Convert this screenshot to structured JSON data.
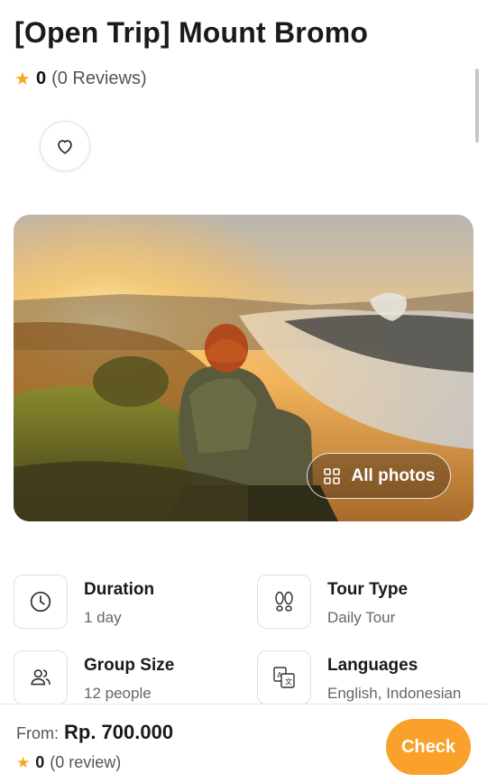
{
  "header": {
    "title": "[Open Trip] Mount Bromo",
    "rating_score": "0",
    "rating_reviews": "(0 Reviews)"
  },
  "gallery": {
    "all_photos_label": "All photos"
  },
  "features": [
    {
      "label": "Duration",
      "value": "1 day",
      "icon": "clock-icon"
    },
    {
      "label": "Tour Type",
      "value": "Daily Tour",
      "icon": "footprints-icon"
    },
    {
      "label": "Group Size",
      "value": "12 people",
      "icon": "group-icon"
    },
    {
      "label": "Languages",
      "value": "English, Indonesian",
      "icon": "translate-icon"
    }
  ],
  "booking": {
    "from_label": "From:",
    "price": "Rp. 700.000",
    "rating_score": "0",
    "rating_reviews": "(0 review)",
    "check_label": "Check"
  },
  "colors": {
    "accent": "#f9a12a",
    "star": "#f5a623"
  }
}
